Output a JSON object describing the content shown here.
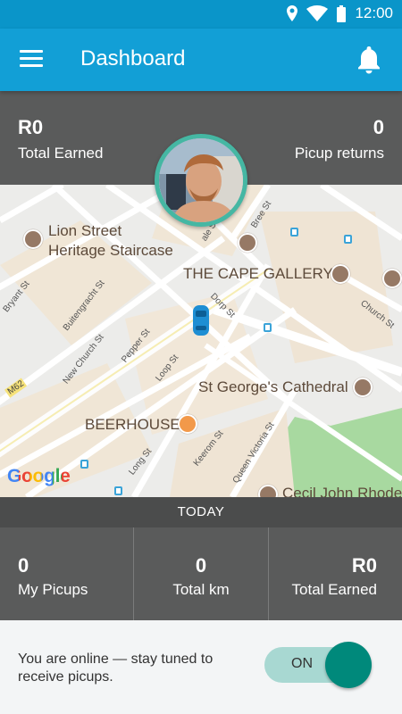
{
  "status_bar": {
    "time": "12:00"
  },
  "app_bar": {
    "title": "Dashboard",
    "menu_icon": "hamburger-menu-icon",
    "notification_icon": "bell-icon"
  },
  "summary": {
    "earned_value": "R0",
    "earned_label": "Total Earned",
    "returns_value": "0",
    "returns_label": "Picup returns"
  },
  "map": {
    "places": {
      "lion_street_1": "Lion Street",
      "lion_street_2": "Heritage Staircase",
      "cape_gallery": "THE CAPE GALLERY",
      "cathedral": "St George's Cathedral",
      "beerhouse": "BEERHOUSE",
      "cecil": "Cecil John Rhode"
    },
    "streets": {
      "bryant": "Bryant St",
      "buitengracht": "Buitengracht St",
      "new_church": "New Church St",
      "pepper": "Pepper St",
      "loop": "Loop St",
      "dorp": "Dorp St",
      "bree": "Bree St",
      "church": "Church St",
      "long": "Long St",
      "keerom": "Keerom St",
      "queen_victoria": "Queen Victoria St",
      "m62": "M62",
      "wale": "ale St"
    },
    "attribution": "Google"
  },
  "today": {
    "label": "TODAY"
  },
  "daily_stats": [
    {
      "value": "0",
      "label": "My Picups"
    },
    {
      "value": "0",
      "label": "Total km"
    },
    {
      "value": "R0",
      "label": "Total Earned"
    }
  ],
  "footer": {
    "message": "You are online — stay tuned to receive picups.",
    "toggle_label": "ON"
  },
  "colors": {
    "primary": "#129fd6",
    "accent": "#00897b",
    "stats_bg": "#5a5b5b"
  }
}
